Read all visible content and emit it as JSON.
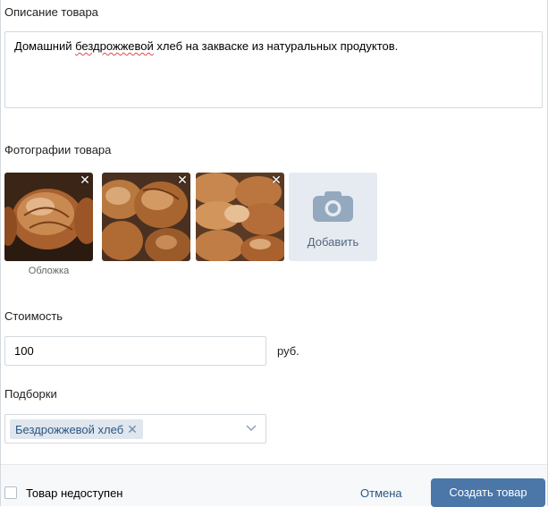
{
  "description": {
    "label": "Описание товара",
    "text_before": "Домашний ",
    "text_misspelled": "бездрожжевой",
    "text_after": " хлеб на закваске из натуральных продуктов."
  },
  "photos": {
    "label": "Фотографии товара",
    "cover_label": "Обложка",
    "add_label": "Добавить",
    "remove_symbol": "✕",
    "colors": {
      "add_tile_bg": "#e5ebf1",
      "camera_icon": "#94a8be"
    }
  },
  "price": {
    "label": "Стоимость",
    "value": "100",
    "currency": "руб."
  },
  "collections": {
    "label": "Подборки",
    "selected": [
      {
        "name": "Бездрожжевой хлеб",
        "remove_symbol": "✕"
      }
    ]
  },
  "footer": {
    "unavailable_label": "Товар недоступен",
    "unavailable_checked": false,
    "cancel_label": "Отмена",
    "create_label": "Создать товар",
    "colors": {
      "primary": "#4a76a8",
      "link": "#2a5885"
    }
  }
}
